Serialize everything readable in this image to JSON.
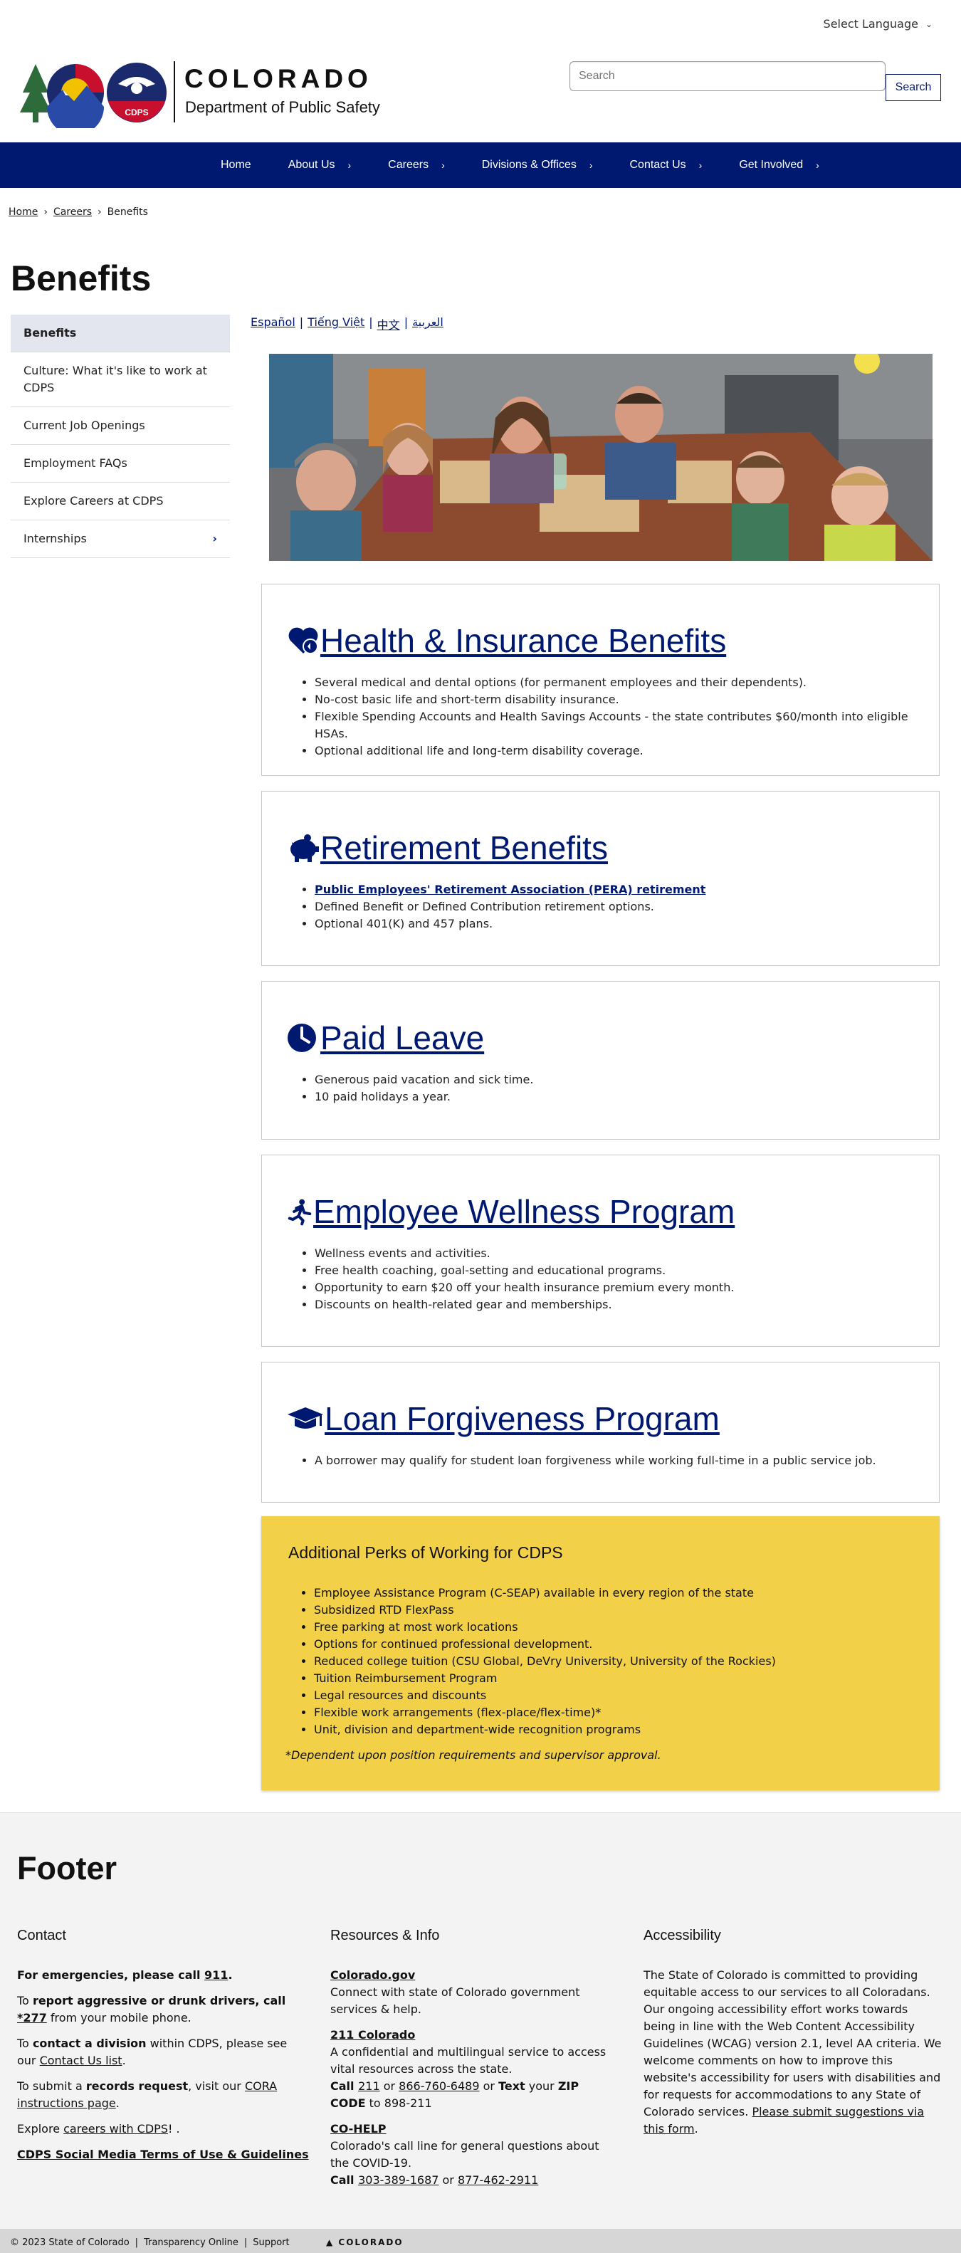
{
  "language": {
    "label": "Select Language"
  },
  "header": {
    "org_name": "COLORADO",
    "dept_name": "Department of Public Safety",
    "logo_badge": "CDPS",
    "search_placeholder": "Search",
    "search_button": "Search"
  },
  "nav": [
    {
      "label": "Home"
    },
    {
      "label": "About Us"
    },
    {
      "label": "Careers"
    },
    {
      "label": "Divisions & Offices"
    },
    {
      "label": "Contact Us"
    },
    {
      "label": "Get Involved"
    }
  ],
  "breadcrumb": {
    "home": "Home",
    "careers": "Careers",
    "current": "Benefits"
  },
  "page_title": "Benefits",
  "sidebar": [
    {
      "label": "Benefits"
    },
    {
      "label": "Culture: What it's like to work at CDPS"
    },
    {
      "label": "Current Job Openings"
    },
    {
      "label": "Employment FAQs"
    },
    {
      "label": "Explore Careers at CDPS"
    },
    {
      "label": "Internships"
    }
  ],
  "lang_links": {
    "es": "Español ",
    "vi": " Tiếng Việt",
    "zh": "中文",
    "ar": "العربية"
  },
  "cards": {
    "health": {
      "title": "Health & Insurance Benefits",
      "items": [
        "Several medical and dental options (for permanent employees and their dependents).",
        "No-cost basic life and short-term disability insurance.",
        "Flexible Spending Accounts and Health Savings Accounts - the state contributes $60/month into eligible HSAs.",
        "Optional additional life and long-term disability coverage."
      ]
    },
    "retirement": {
      "title": "Retirement Benefits",
      "link": "Public Employees' Retirement Association (PERA) retirement",
      "items": [
        "Defined Benefit or Defined Contribution retirement options.",
        "Optional 401(K) and 457 plans."
      ]
    },
    "leave": {
      "title": "Paid Leave",
      "items": [
        "Generous paid vacation and sick time.",
        "10 paid holidays a year."
      ]
    },
    "wellness": {
      "title": "Employee Wellness Program",
      "items": [
        "Wellness events and activities.",
        "Free health coaching, goal-setting and educational programs.",
        "Opportunity to earn $20 off your health insurance premium every month.",
        "Discounts on health-related gear and memberships."
      ]
    },
    "loan": {
      "title": "Loan Forgiveness Program",
      "items": [
        "A borrower may qualify for student loan forgiveness while working full-time in a public service job."
      ]
    }
  },
  "perks": {
    "title": "Additional Perks of Working for CDPS",
    "items": [
      "Employee Assistance Program (C-SEAP) available in every region of the state",
      "Subsidized RTD FlexPass",
      "Free parking at most work locations",
      "Options for continued professional development.",
      "Reduced college tuition (CSU Global, DeVry University, University of the Rockies)",
      "Tuition Reimbursement Program",
      "Legal resources and discounts",
      "Flexible work arrangements (flex-place/flex-time)*",
      "Unit, division and department-wide recognition programs"
    ],
    "note": "*Dependent upon position requirements and supervisor approval."
  },
  "footer": {
    "title": "Footer",
    "contact": {
      "heading": "Contact",
      "emergency_prefix": "For emergencies, please call ",
      "emergency_number": "911",
      "report_prefix": "To ",
      "report_bold": "report aggressive or drunk drivers, call ",
      "report_number": "*277",
      "report_suffix": " from your mobile phone.",
      "division_prefix": "To ",
      "division_bold": "contact a division",
      "division_mid": " within CDPS, please see our ",
      "division_link": "Contact Us list",
      "division_suffix": ".",
      "records_prefix": "To submit a ",
      "records_bold": "records request",
      "records_mid": ", visit our ",
      "records_link": "CORA instructions page",
      "records_suffix": ".",
      "explore_prefix": "Explore ",
      "explore_link": "careers with CDPS",
      "explore_suffix": "! .",
      "social_link": "CDPS Social Media Terms of Use & Guidelines"
    },
    "resources": {
      "heading": "Resources & Info",
      "cogov_link": "Colorado.gov",
      "cogov_text": "Connect with state of Colorado government services & help.",
      "co211_link": "211 Colorado",
      "co211_text": "A confidential and multilingual service to access vital resources across the state.",
      "call_label": "Call ",
      "co211_num1": "211",
      "or1": " or ",
      "co211_num2": "866-760-6489",
      "or_text": " or ",
      "text_label": "Text",
      "your_label": " your ",
      "zip_label": "ZIP CODE",
      "to_label": " to 898-211",
      "cohelp_link": "CO-HELP",
      "cohelp_text": "Colorado's call line for general questions about the COVID-19.",
      "call_label2": "Call ",
      "cohelp_num1": "303-389-1687",
      "or2": " or ",
      "cohelp_num2": "877-462-2911"
    },
    "accessibility": {
      "heading": "Accessibility",
      "text": "The State of Colorado is committed to providing equitable access to our services to all Coloradans. Our ongoing accessibility effort works towards being in line with the Web Content Accessibility Guidelines (WCAG) version 2.1, level AA criteria. We welcome comments on how to improve this website's accessibility for users with disabilities and for requests for accommodations to any State of Colorado services. ",
      "link": "Please submit suggestions via this form",
      "suffix": "."
    }
  },
  "bottom": {
    "copyright": "© 2023 State of Colorado",
    "transparency": "Transparency Online",
    "support": "Support",
    "sep": "|",
    "logo": "COLORADO"
  },
  "colors": {
    "navy": "#001970",
    "perks_yellow": "#f2d048",
    "footer_bg": "#f3f3f3"
  },
  "icons": {
    "health": "heart-shield-icon",
    "retirement": "piggy-bank-icon",
    "leave": "clock-icon",
    "wellness": "running-person-icon",
    "loan": "graduation-cap-icon"
  }
}
